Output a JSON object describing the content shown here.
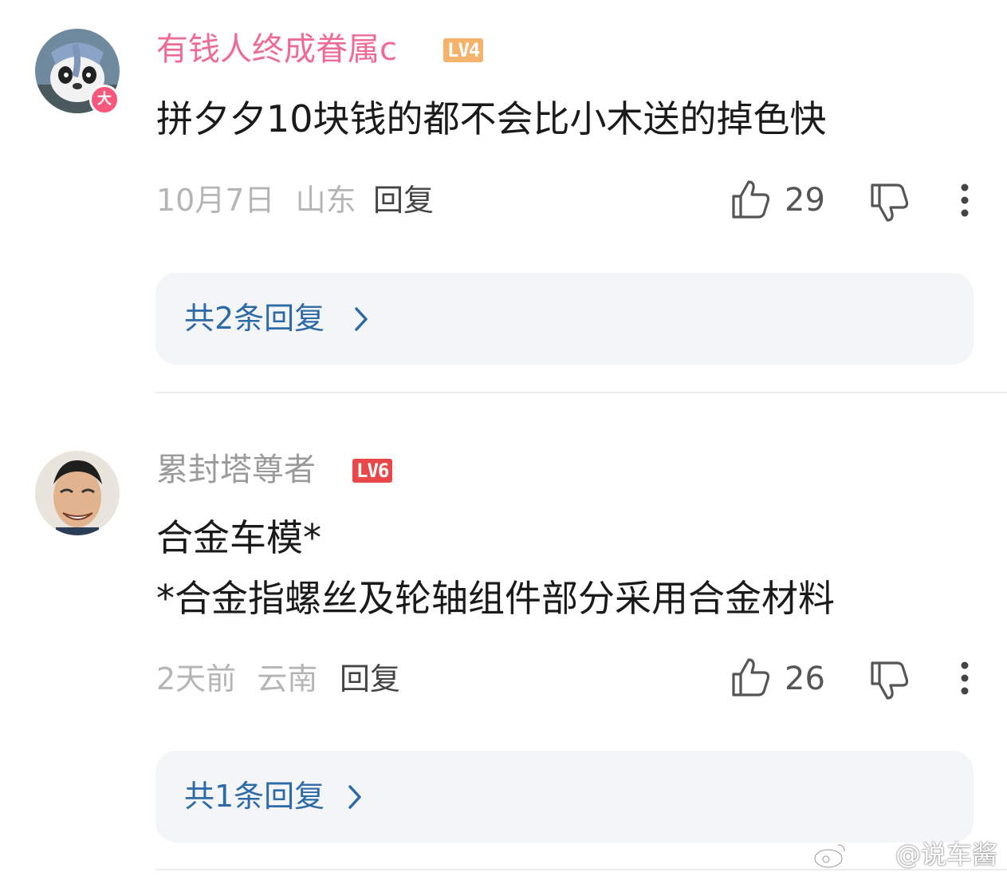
{
  "comments": [
    {
      "username": "有钱人终成眷属c",
      "username_color": "#ef6b93",
      "level": "LV4",
      "level_color": "#f5b26b",
      "avatar_badge": "大",
      "content_lines": [
        "拼夕夕10块钱的都不会比小木送的掉色快"
      ],
      "date": "10月7日",
      "location": "山东",
      "reply_label": "回复",
      "like_count": "29",
      "replies_label": "共2条回复",
      "avatar_icon": "panda-elephant-avatar"
    },
    {
      "username": "累封塔尊者",
      "username_color": "#9a9a9a",
      "level": "LV6",
      "level_color": "#e8484a",
      "content_lines": [
        "合金车模*",
        "*合金指螺丝及轮轴组件部分采用合金材料"
      ],
      "date": "2天前",
      "location": "云南",
      "reply_label": "回复",
      "like_count": "26",
      "replies_label": "共1条回复",
      "avatar_icon": "smiling-man-avatar"
    }
  ],
  "icons": {
    "like": "thumbs-up-icon",
    "dislike": "thumbs-down-icon",
    "more": "more-vertical-icon",
    "chevron": "chevron-right-icon"
  },
  "watermark": "@说车酱"
}
